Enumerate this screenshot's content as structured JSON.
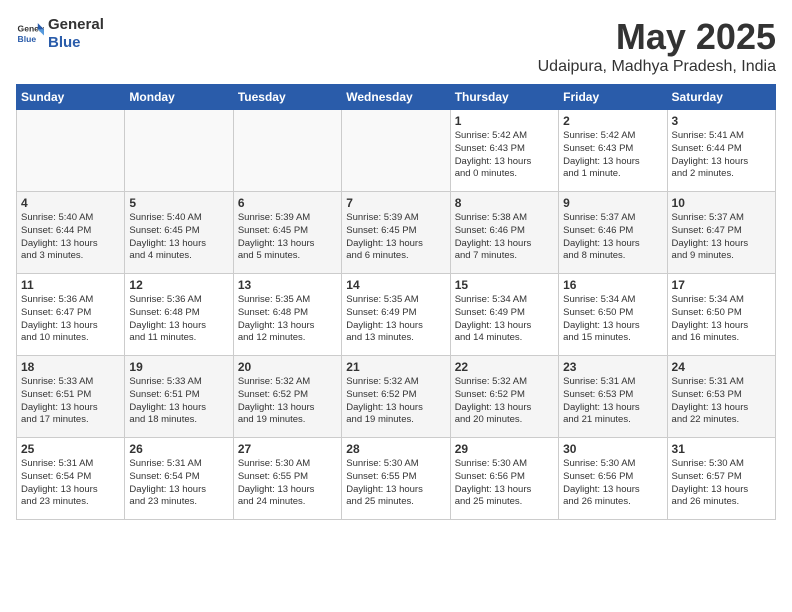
{
  "logo": {
    "general": "General",
    "blue": "Blue"
  },
  "header": {
    "month_year": "May 2025",
    "location": "Udaipura, Madhya Pradesh, India"
  },
  "days_of_week": [
    "Sunday",
    "Monday",
    "Tuesday",
    "Wednesday",
    "Thursday",
    "Friday",
    "Saturday"
  ],
  "weeks": [
    [
      {
        "day": "",
        "info": ""
      },
      {
        "day": "",
        "info": ""
      },
      {
        "day": "",
        "info": ""
      },
      {
        "day": "",
        "info": ""
      },
      {
        "day": "1",
        "info": "Sunrise: 5:42 AM\nSunset: 6:43 PM\nDaylight: 13 hours\nand 0 minutes."
      },
      {
        "day": "2",
        "info": "Sunrise: 5:42 AM\nSunset: 6:43 PM\nDaylight: 13 hours\nand 1 minute."
      },
      {
        "day": "3",
        "info": "Sunrise: 5:41 AM\nSunset: 6:44 PM\nDaylight: 13 hours\nand 2 minutes."
      }
    ],
    [
      {
        "day": "4",
        "info": "Sunrise: 5:40 AM\nSunset: 6:44 PM\nDaylight: 13 hours\nand 3 minutes."
      },
      {
        "day": "5",
        "info": "Sunrise: 5:40 AM\nSunset: 6:45 PM\nDaylight: 13 hours\nand 4 minutes."
      },
      {
        "day": "6",
        "info": "Sunrise: 5:39 AM\nSunset: 6:45 PM\nDaylight: 13 hours\nand 5 minutes."
      },
      {
        "day": "7",
        "info": "Sunrise: 5:39 AM\nSunset: 6:45 PM\nDaylight: 13 hours\nand 6 minutes."
      },
      {
        "day": "8",
        "info": "Sunrise: 5:38 AM\nSunset: 6:46 PM\nDaylight: 13 hours\nand 7 minutes."
      },
      {
        "day": "9",
        "info": "Sunrise: 5:37 AM\nSunset: 6:46 PM\nDaylight: 13 hours\nand 8 minutes."
      },
      {
        "day": "10",
        "info": "Sunrise: 5:37 AM\nSunset: 6:47 PM\nDaylight: 13 hours\nand 9 minutes."
      }
    ],
    [
      {
        "day": "11",
        "info": "Sunrise: 5:36 AM\nSunset: 6:47 PM\nDaylight: 13 hours\nand 10 minutes."
      },
      {
        "day": "12",
        "info": "Sunrise: 5:36 AM\nSunset: 6:48 PM\nDaylight: 13 hours\nand 11 minutes."
      },
      {
        "day": "13",
        "info": "Sunrise: 5:35 AM\nSunset: 6:48 PM\nDaylight: 13 hours\nand 12 minutes."
      },
      {
        "day": "14",
        "info": "Sunrise: 5:35 AM\nSunset: 6:49 PM\nDaylight: 13 hours\nand 13 minutes."
      },
      {
        "day": "15",
        "info": "Sunrise: 5:34 AM\nSunset: 6:49 PM\nDaylight: 13 hours\nand 14 minutes."
      },
      {
        "day": "16",
        "info": "Sunrise: 5:34 AM\nSunset: 6:50 PM\nDaylight: 13 hours\nand 15 minutes."
      },
      {
        "day": "17",
        "info": "Sunrise: 5:34 AM\nSunset: 6:50 PM\nDaylight: 13 hours\nand 16 minutes."
      }
    ],
    [
      {
        "day": "18",
        "info": "Sunrise: 5:33 AM\nSunset: 6:51 PM\nDaylight: 13 hours\nand 17 minutes."
      },
      {
        "day": "19",
        "info": "Sunrise: 5:33 AM\nSunset: 6:51 PM\nDaylight: 13 hours\nand 18 minutes."
      },
      {
        "day": "20",
        "info": "Sunrise: 5:32 AM\nSunset: 6:52 PM\nDaylight: 13 hours\nand 19 minutes."
      },
      {
        "day": "21",
        "info": "Sunrise: 5:32 AM\nSunset: 6:52 PM\nDaylight: 13 hours\nand 19 minutes."
      },
      {
        "day": "22",
        "info": "Sunrise: 5:32 AM\nSunset: 6:52 PM\nDaylight: 13 hours\nand 20 minutes."
      },
      {
        "day": "23",
        "info": "Sunrise: 5:31 AM\nSunset: 6:53 PM\nDaylight: 13 hours\nand 21 minutes."
      },
      {
        "day": "24",
        "info": "Sunrise: 5:31 AM\nSunset: 6:53 PM\nDaylight: 13 hours\nand 22 minutes."
      }
    ],
    [
      {
        "day": "25",
        "info": "Sunrise: 5:31 AM\nSunset: 6:54 PM\nDaylight: 13 hours\nand 23 minutes."
      },
      {
        "day": "26",
        "info": "Sunrise: 5:31 AM\nSunset: 6:54 PM\nDaylight: 13 hours\nand 23 minutes."
      },
      {
        "day": "27",
        "info": "Sunrise: 5:30 AM\nSunset: 6:55 PM\nDaylight: 13 hours\nand 24 minutes."
      },
      {
        "day": "28",
        "info": "Sunrise: 5:30 AM\nSunset: 6:55 PM\nDaylight: 13 hours\nand 25 minutes."
      },
      {
        "day": "29",
        "info": "Sunrise: 5:30 AM\nSunset: 6:56 PM\nDaylight: 13 hours\nand 25 minutes."
      },
      {
        "day": "30",
        "info": "Sunrise: 5:30 AM\nSunset: 6:56 PM\nDaylight: 13 hours\nand 26 minutes."
      },
      {
        "day": "31",
        "info": "Sunrise: 5:30 AM\nSunset: 6:57 PM\nDaylight: 13 hours\nand 26 minutes."
      }
    ]
  ]
}
